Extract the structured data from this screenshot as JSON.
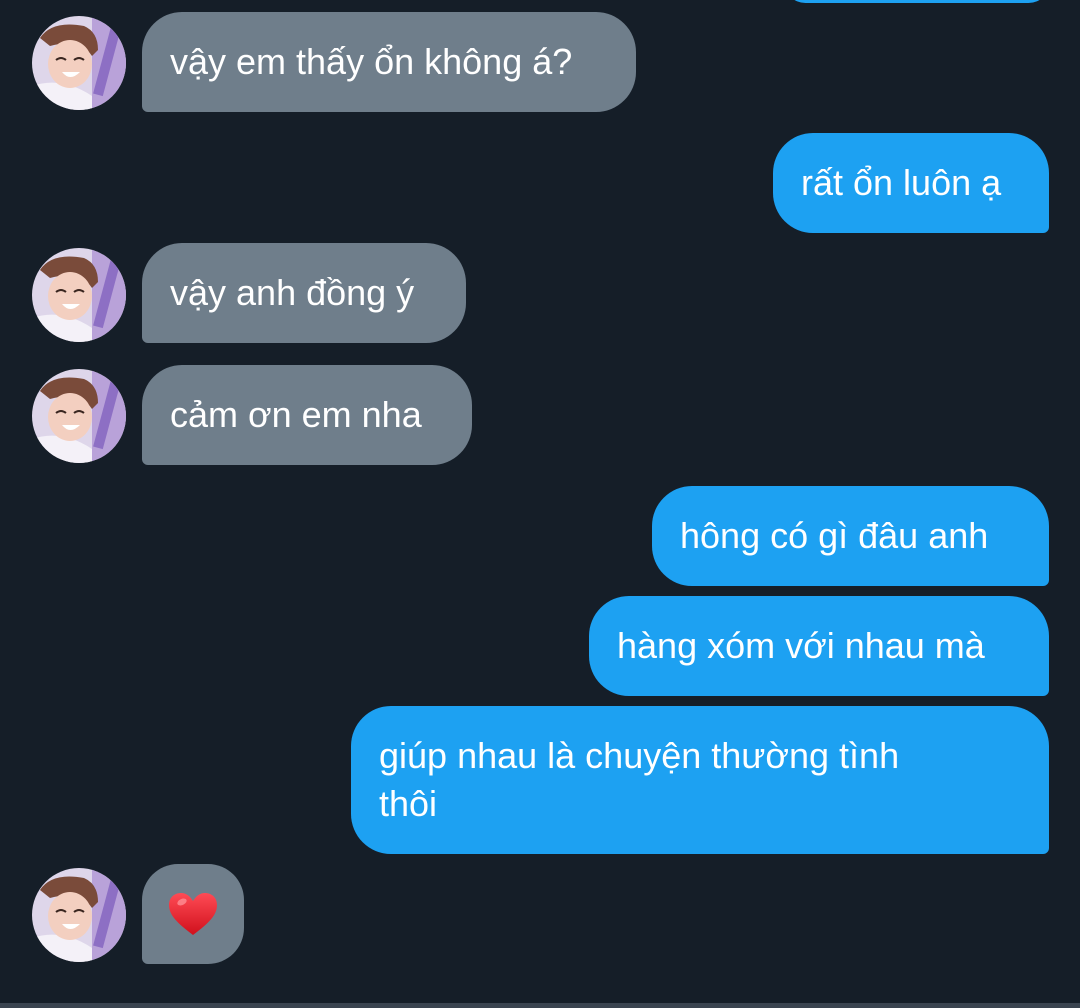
{
  "chat": {
    "colors": {
      "background": "#151e28",
      "incoming_bubble": "#6f7e8b",
      "outgoing_bubble": "#1da1f2",
      "text": "#ffffff"
    },
    "messages": [
      {
        "side": "in",
        "text": "vậy em thấy ổn không á?",
        "avatar": "profile-photo"
      },
      {
        "side": "out",
        "text": "rất ổn luôn ạ"
      },
      {
        "side": "in",
        "text": "vậy anh đồng ý",
        "avatar": "profile-photo"
      },
      {
        "side": "in",
        "text": "cảm ơn em nha",
        "avatar": "profile-photo"
      },
      {
        "side": "out",
        "text": "hông có gì đâu anh"
      },
      {
        "side": "out",
        "text": "hàng xóm với nhau mà"
      },
      {
        "side": "out",
        "text": "giúp nhau là chuyện thường tình\nthôi"
      },
      {
        "side": "in",
        "emoji": "heart-icon",
        "avatar": "profile-photo"
      }
    ]
  }
}
